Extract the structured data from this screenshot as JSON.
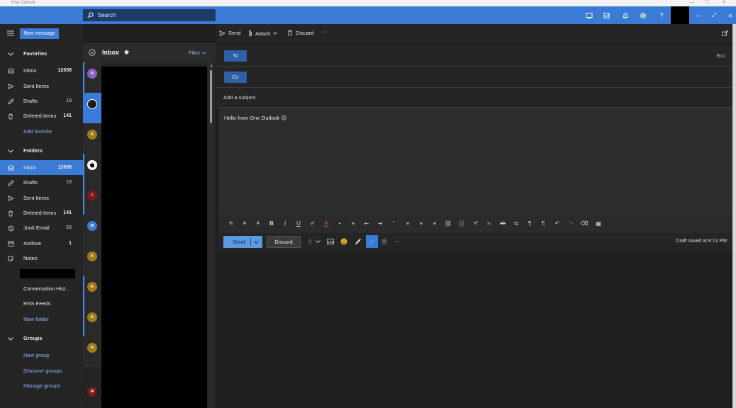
{
  "window": {
    "title": "One Outlook",
    "controls": [
      "—",
      "☐",
      "✕"
    ]
  },
  "header": {
    "search_label": "Search",
    "icons": [
      "teams-icon",
      "planner-icon",
      "bell-icon",
      "gear-icon",
      "help-icon"
    ],
    "help_glyph": "?",
    "window_controls": [
      "—",
      "⤢",
      "✕"
    ]
  },
  "nav": {
    "new_message": "New message",
    "favorites_header": "Favorites",
    "favorites": [
      {
        "label": "Inbox",
        "count": "12658"
      },
      {
        "label": "Sent Items",
        "count": ""
      },
      {
        "label": "Drafts",
        "count": "19"
      },
      {
        "label": "Deleted Items",
        "count": "141"
      }
    ],
    "add_favorite": "Add favorite",
    "folders_header": "Folders",
    "folders": [
      {
        "label": "Inbox",
        "count": "12658"
      },
      {
        "label": "Drafts",
        "count": "19"
      },
      {
        "label": "Sent Items",
        "count": ""
      },
      {
        "label": "Deleted Items",
        "count": "141"
      },
      {
        "label": "Junk Email",
        "count": "53"
      },
      {
        "label": "Archive",
        "count": "1"
      },
      {
        "label": "Notes",
        "count": ""
      }
    ],
    "conversation_history": "Conversation Hist...",
    "rss_feeds": "RSS Feeds",
    "new_folder": "New folder",
    "groups_header": "Groups",
    "new_group": "New group",
    "discover_groups": "Discover groups",
    "manage_groups": "Manage groups"
  },
  "message_list": {
    "title": "Inbox",
    "filter": "Filter",
    "avatars": [
      {
        "letter": "N",
        "color": "#8b5fbf"
      },
      {
        "letter": "",
        "color": "#1b1b1b"
      },
      {
        "letter": "A",
        "color": "#a07a1c"
      },
      {
        "letter": "",
        "color": "#ffffff"
      },
      {
        "letter": "I",
        "color": "#7a1a1a"
      },
      {
        "letter": "M",
        "color": "#3a7bd5"
      },
      {
        "letter": "A",
        "color": "#a07a1c"
      },
      {
        "letter": "A",
        "color": "#a07a1c"
      },
      {
        "letter": "A",
        "color": "#a07a1c"
      },
      {
        "letter": "A",
        "color": "#a07a1c"
      },
      {
        "letter": "M",
        "color": "#7a1a1a"
      }
    ]
  },
  "compose": {
    "send": "Send",
    "attach": "Attach",
    "discard": "Discard",
    "more": "···",
    "to": "To",
    "cc": "Cc",
    "bcc": "Bcc",
    "subject_placeholder": "Add a subject",
    "body": "Hello from One Outlook 😊",
    "format_glyphs": [
      "✎",
      "A",
      "A",
      "B",
      "I",
      "U",
      "✐",
      "A",
      "•",
      "≡",
      "⇤",
      "⇥",
      "”",
      "≡",
      "≡",
      "≡",
      "⛓",
      "⛓",
      "x²",
      "x₂",
      "ab",
      "⇆",
      "¶",
      "¶",
      "↶",
      "↷",
      "⌫",
      "▦"
    ],
    "send_button": "Send",
    "discard_button": "Discard",
    "draft_status": "Draft saved at 8:13 PM"
  },
  "colors": {
    "accent": "#3a7bd5",
    "nav_bg": "#252525",
    "body_bg": "#2d2d2d"
  }
}
